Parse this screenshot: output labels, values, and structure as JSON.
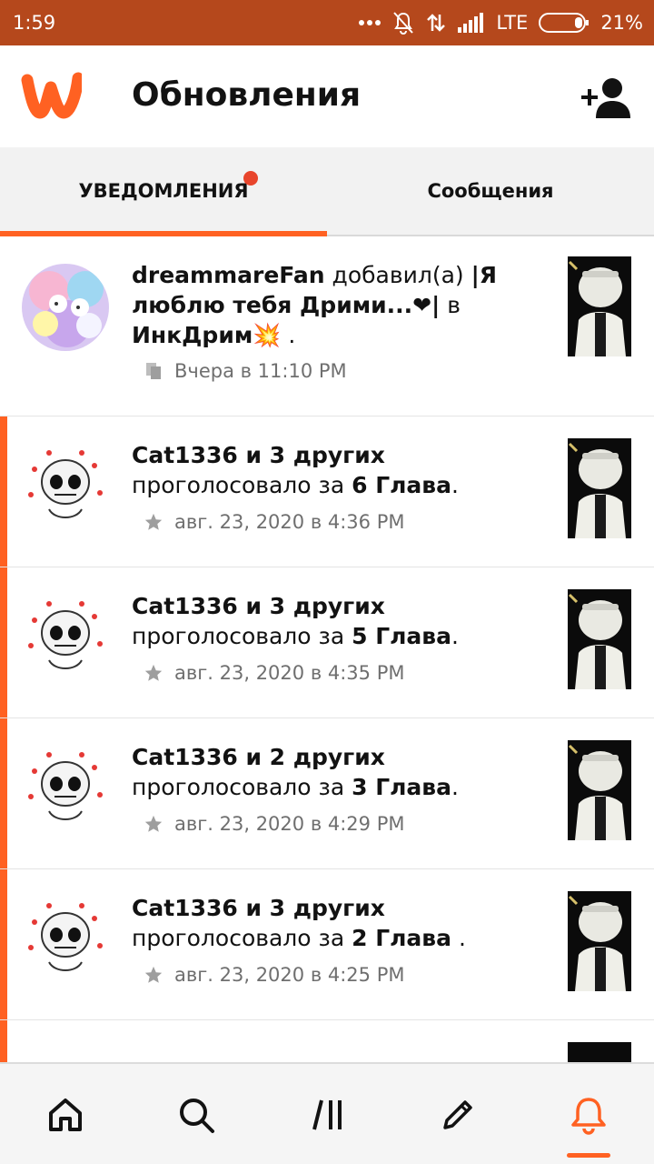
{
  "status_bar": {
    "time": "1:59",
    "network": "LTE",
    "battery": "21%"
  },
  "header": {
    "title": "Обновления",
    "logo_icon": "wattpad-logo",
    "add_friend_icon": "add-user-icon"
  },
  "tabs": [
    {
      "label": "УВЕДОМЛЕНИЯ",
      "active": true,
      "has_dot": true
    },
    {
      "label": "Сообщения",
      "active": false
    }
  ],
  "notifications": [
    {
      "actor": "dreammareFan",
      "text_mid": " добавил(а) ",
      "story": "|Я люблю тебя Дрими...❤|",
      "text_in": " в ",
      "list_name": "ИнкДрим",
      "list_emoji": "💥",
      "text_end": " .",
      "time": "Вчера в 11:10 PM",
      "meta_icon": "copy-icon",
      "unread": false
    },
    {
      "actor": "Cat1336 и 3 других",
      "text_mid": " проголосовало за ",
      "chapter": "6 Глава",
      "text_end": ".",
      "time": "авг. 23, 2020 в 4:36 PM",
      "meta_icon": "star-icon",
      "unread": true
    },
    {
      "actor": "Cat1336 и 3 других",
      "text_mid": " проголосовало за ",
      "chapter": "5 Глава",
      "text_end": ".",
      "time": "авг. 23, 2020 в 4:35 PM",
      "meta_icon": "star-icon",
      "unread": true
    },
    {
      "actor": "Cat1336 и 2 других",
      "text_mid": " проголосовало за ",
      "chapter": "3 Глава",
      "text_end": ".",
      "time": "авг. 23, 2020 в 4:29 PM",
      "meta_icon": "star-icon",
      "unread": true
    },
    {
      "actor": "Cat1336 и 3 других",
      "text_mid": " проголосовало за ",
      "chapter": "2 Глава",
      "text_end": " .",
      "time": "авг. 23, 2020 в 4:25 PM",
      "meta_icon": "star-icon",
      "unread": true
    }
  ],
  "bottom_nav": [
    {
      "icon": "home-icon",
      "active": false
    },
    {
      "icon": "search-icon",
      "active": false
    },
    {
      "icon": "library-icon",
      "active": false
    },
    {
      "icon": "write-icon",
      "active": false
    },
    {
      "icon": "bell-icon",
      "active": true
    }
  ],
  "colors": {
    "brand": "#ff6122",
    "status_bar": "#b5481c",
    "notification_dot": "#e8452c"
  }
}
